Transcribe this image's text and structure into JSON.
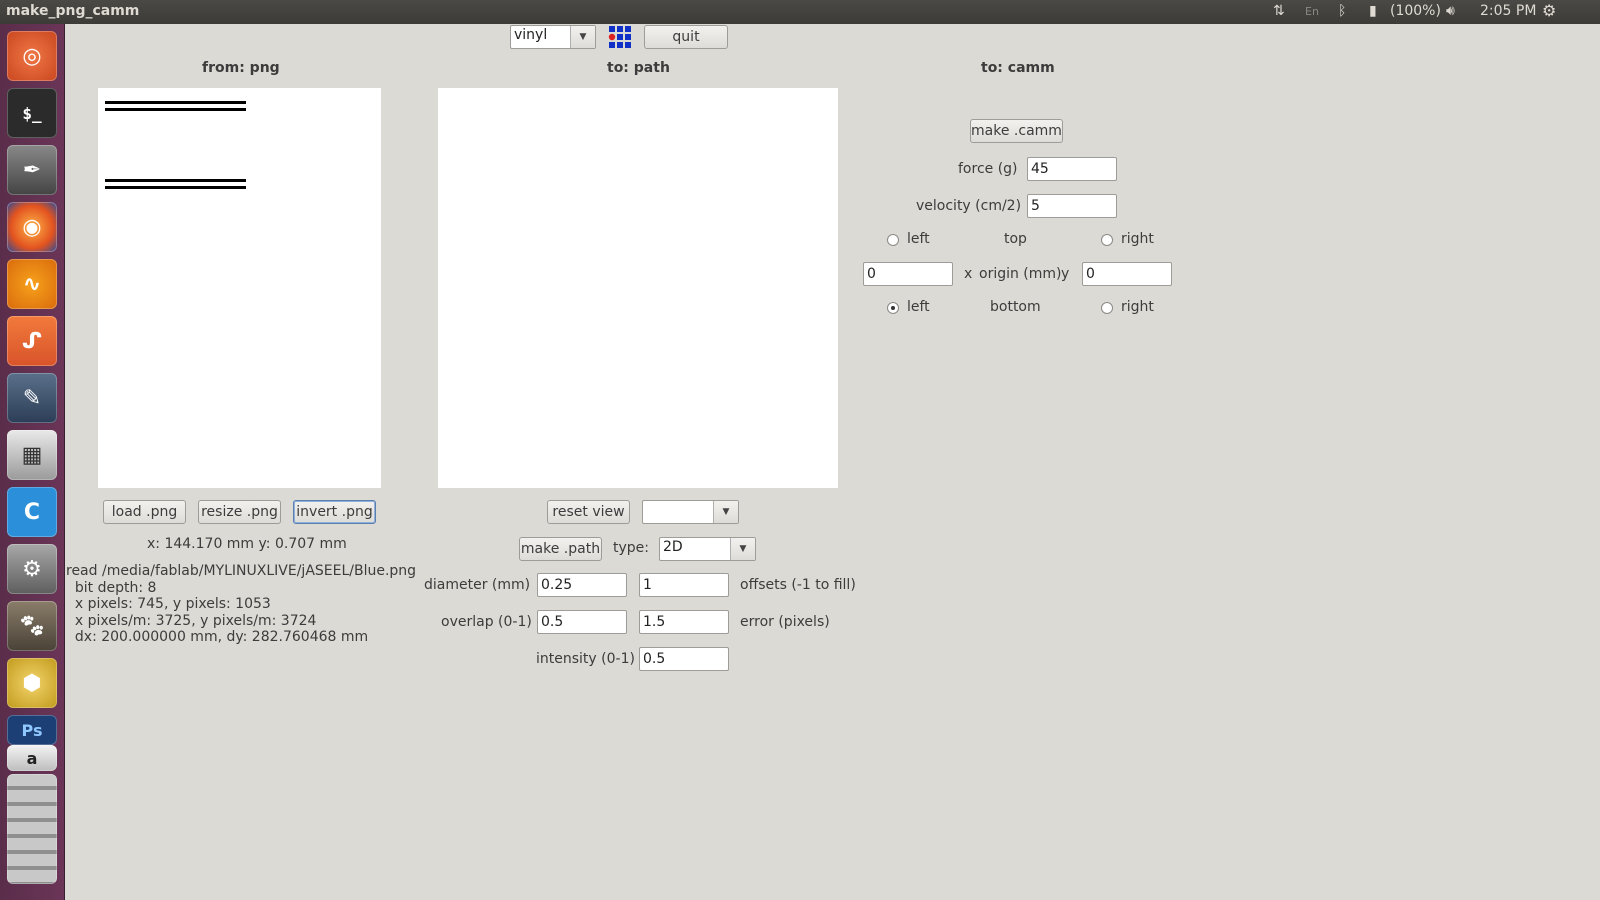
{
  "window": {
    "title": "make_png_camm"
  },
  "indicators": {
    "battery": "(100%)",
    "clock": "2:05 PM",
    "keyboard": "En"
  },
  "launcher": [
    {
      "name": "ubuntu-dash"
    },
    {
      "name": "terminal"
    },
    {
      "name": "inkscape"
    },
    {
      "name": "firefox"
    },
    {
      "name": "audio-app"
    },
    {
      "name": "ubuntu-one"
    },
    {
      "name": "text-editor"
    },
    {
      "name": "libreoffice-calc"
    },
    {
      "name": "code-editor"
    },
    {
      "name": "system-settings"
    },
    {
      "name": "gimp"
    },
    {
      "name": "3d-app"
    },
    {
      "name": "photoshop"
    },
    {
      "name": "amazon"
    }
  ],
  "toolbar": {
    "machine": "vinyl",
    "quit_label": "quit"
  },
  "png_panel": {
    "header": "from: png",
    "load_label": "load .png",
    "resize_label": "resize .png",
    "invert_label": "invert .png",
    "coords": "x: 144.170 mm  y: 0.707 mm",
    "info": "read /media/fablab/MYLINUXLIVE/jASEEL/Blue.png\n  bit depth: 8\n  x pixels: 745, y pixels: 1053\n  x pixels/m: 3725, y pixels/m: 3724\n  dx: 200.000000 mm, dy: 282.760468 mm"
  },
  "path_panel": {
    "header": "to: path",
    "reset_view_label": "reset view",
    "view_select": "",
    "make_path_label": "make .path",
    "type_label": "type:",
    "type_value": "2D",
    "diameter_label": "diameter (mm)",
    "diameter_value": "0.25",
    "offsets_value": "1",
    "offsets_label": "offsets (-1 to fill)",
    "overlap_label": "overlap (0-1)",
    "overlap_value": "0.5",
    "error_value": "1.5",
    "error_label": "error (pixels)",
    "intensity_label": "intensity (0-1)",
    "intensity_value": "0.5"
  },
  "camm_panel": {
    "header": "to: camm",
    "make_camm_label": "make .camm",
    "force_label": "force (g)",
    "force_value": "45",
    "velocity_label": "velocity (cm/2)",
    "velocity_value": "5",
    "top_left_label": "left",
    "top_label": "top",
    "top_right_label": "right",
    "x_origin_value": "0",
    "x_label": "x",
    "origin_label": "origin (mm)",
    "y_label": "y",
    "y_origin_value": "0",
    "bottom_left_label": "left",
    "bottom_label": "bottom",
    "bottom_right_label": "right",
    "origin_selected": "bottom-left"
  }
}
